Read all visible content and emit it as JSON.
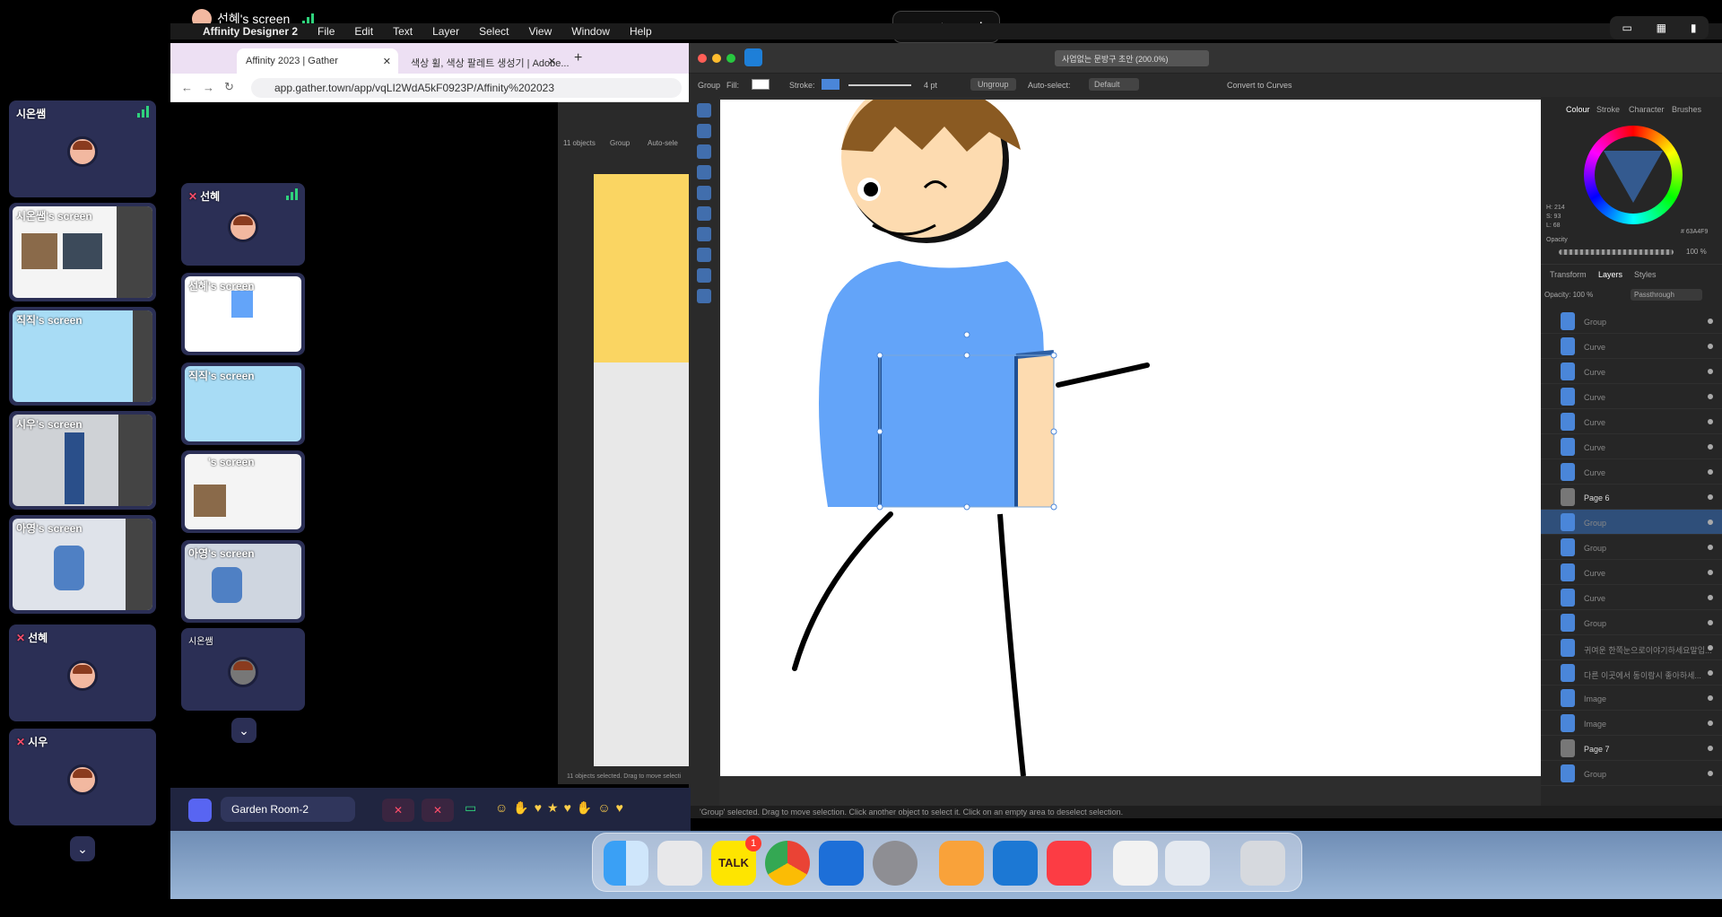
{
  "screen_share": {
    "presenter_name": "선혜's screen"
  },
  "menubar": {
    "app": "Affinity Designer 2",
    "items": [
      "File",
      "Edit",
      "Text",
      "Layer",
      "Select",
      "View",
      "Window",
      "Help"
    ]
  },
  "chrome": {
    "tabs": [
      {
        "label": "Affinity 2023 | Gather"
      },
      {
        "label": "색상 휠, 색상 팔레트 생성기 | Adobe..."
      }
    ],
    "url": "app.gather.town/app/vqLI2WdA5kF0923P/Affinity%202023"
  },
  "left_tiles": [
    {
      "name": "시온쌤",
      "type": "avatar"
    },
    {
      "name": "시온쌤's screen",
      "type": "screen"
    },
    {
      "name": "직직's screen",
      "type": "screen"
    },
    {
      "name": "시우's screen",
      "type": "screen"
    },
    {
      "name": "아영's screen",
      "type": "screen"
    },
    {
      "name": "선혜",
      "type": "avatar-muted"
    },
    {
      "name": "시우",
      "type": "avatar-muted"
    }
  ],
  "mid_tiles": [
    {
      "name": "선혜",
      "type": "avatar-muted"
    },
    {
      "name": "선혜's screen",
      "type": "screen"
    },
    {
      "name": "직직's screen",
      "type": "screen"
    },
    {
      "name": "'s screen",
      "type": "screen"
    },
    {
      "name": "아영's screen",
      "type": "screen"
    },
    {
      "name": "시온쌤",
      "type": "avatar"
    }
  ],
  "inner_affinity": {
    "objects": "11 objects",
    "group": "Group",
    "autoselect": "Auto-sele",
    "status": "11 objects selected. Drag to move selecti"
  },
  "affinity": {
    "zoom_doc": "사업없는 문방구 초안 (200.0%)",
    "context": {
      "group": "Group",
      "fill": "Fill:",
      "stroke": "Stroke:",
      "stroke_width": "4 pt",
      "ungroup": "Ungroup",
      "autoselect": "Auto-select:",
      "autoselect_val": "Default",
      "convert": "Convert to Curves"
    },
    "panel_tabs": [
      "Colour",
      "Stroke",
      "Character",
      "Brushes"
    ],
    "color_values": {
      "h": "H: 214",
      "s": "S: 93",
      "l": "L: 68",
      "hex": "# 63A4F9",
      "opacity_label": "Opacity",
      "opacity": "100 %"
    },
    "layer_tabs": [
      "Transform",
      "Layers",
      "Styles"
    ],
    "layer_opacity": "Opacity: 100 %",
    "blend": "Passthrough",
    "layers": [
      "Group",
      "Curve",
      "Curve",
      "Curve",
      "Curve",
      "Curve",
      "Curve",
      "Page 6",
      "Group",
      "Group",
      "Curve",
      "Curve",
      "Group",
      "귀여운 한쪽눈으로이야기하세요말입...",
      "다른 이곳에서 동이람시 좋아하세...",
      "Image",
      "Image",
      "Page 7",
      "Group"
    ],
    "status": "'Group' selected. Drag to move selection. Click another object to select it. Click on an empty area to deselect selection."
  },
  "gather_bar": {
    "room": "Garden Room-2"
  },
  "dock": {
    "badge": "1",
    "talk_label": "TALK"
  }
}
